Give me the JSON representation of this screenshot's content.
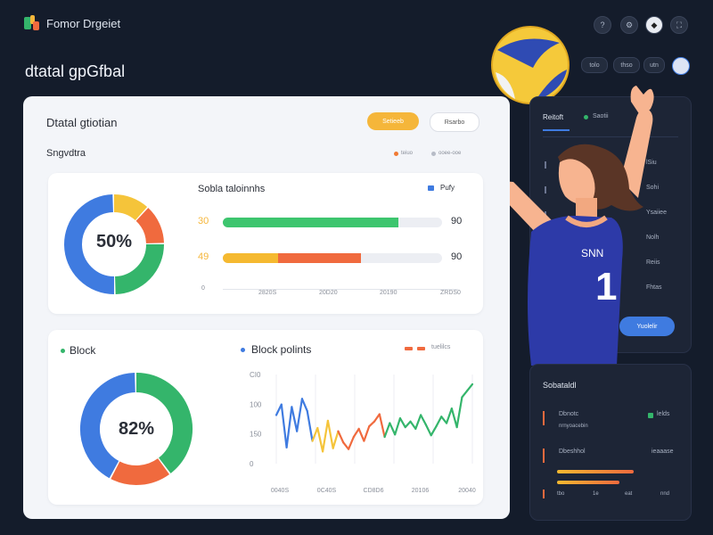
{
  "app": {
    "brand": "Fomor Drgeiet",
    "page_title": "dtatal gpGfbal",
    "top_icons": [
      "help-icon",
      "settings-icon",
      "notification-icon",
      "fullscreen-icon"
    ],
    "secondary_pills": [
      "tolo",
      "thso",
      "utn"
    ]
  },
  "main": {
    "title": "Dtatal gtiotian",
    "btn_primary": "Setieeb",
    "btn_secondary": "Rsarbo",
    "section_label": "Sngvdtra",
    "legend": [
      {
        "label": "teiuo",
        "color": "#f07a34"
      },
      {
        "label": "ooee-ooe",
        "color": "#b7bcc7"
      }
    ],
    "top_panel": {
      "donut": {
        "center_label": "50%",
        "slices": [
          {
            "value": 12,
            "color": "#f5c43a"
          },
          {
            "value": 13,
            "color": "#f06a3e"
          },
          {
            "value": 25,
            "color": "#34b56b"
          },
          {
            "value": 50,
            "color": "#3f7be0"
          }
        ]
      },
      "bars_title": "Sobla taloinnhs",
      "bars_legend": "Pufy",
      "bars": [
        {
          "label": "30",
          "value_label": "90",
          "segments": [
            {
              "fraction": 0.8,
              "color": "#3dc56e"
            }
          ]
        },
        {
          "label": "49",
          "value_label": "90",
          "segments": [
            {
              "fraction": 0.25,
              "color": "#f5b930"
            },
            {
              "fraction": 0.38,
              "color": "#f06a3e"
            }
          ]
        }
      ],
      "axis_zero": "0",
      "ticks": [
        "2820S",
        "20D20",
        "20190",
        "ZRDS0"
      ]
    },
    "bottom_panel": {
      "block_label": "Block",
      "donut": {
        "center_label": "82%",
        "slices": [
          {
            "value": 40,
            "color": "#34b56b"
          },
          {
            "value": 18,
            "color": "#f06a3e"
          },
          {
            "value": 42,
            "color": "#3f7be0"
          }
        ]
      },
      "chart_title": "Block polints",
      "chart_legend": "tuelilcs",
      "y_ticks": [
        "CI0",
        "100",
        "150",
        "0"
      ],
      "x_ticks": [
        "0040S",
        "0C40S",
        "CD8D6",
        "20106",
        "20040"
      ]
    }
  },
  "chart_data": {
    "type": "line",
    "title": "Block polints",
    "ylabel": "",
    "xlabel": "",
    "series": [
      {
        "name": "tuelilcs",
        "values": [
          120,
          133,
          80,
          130,
          100,
          140,
          125,
          88,
          104,
          75,
          113,
          79,
          100,
          86,
          78,
          93,
          103,
          88,
          106,
          112,
          121,
          93,
          110,
          96,
          116,
          105,
          112,
          103,
          120,
          108,
          95,
          106,
          118,
          110,
          128,
          105,
          142,
          150,
          158
        ]
      }
    ],
    "y_tick_labels": [
      "CI0",
      "100",
      "150",
      "0"
    ],
    "x_tick_labels": [
      "0040S",
      "0C40S",
      "CD8D6",
      "20106",
      "20040"
    ]
  },
  "side": {
    "top_card": {
      "title": "Reitoft",
      "tab": "Saotii",
      "tab_color": "#34b56b",
      "rows": [
        "lSiu",
        "Sohi",
        "Ysaiiee",
        "Nolh",
        "Reiis",
        "Fhtas"
      ],
      "button": "Yuolelir"
    },
    "bottom_card": {
      "title": "Sobataldl",
      "items": [
        {
          "label": "Dbnotc",
          "sub": "nrnyoacebin",
          "tag": "lelds",
          "tag_color": "#34b56b"
        },
        {
          "label": "Dbeshhol",
          "sub": "",
          "tag": "ieaaase",
          "tag_color": "#f06a3e"
        }
      ],
      "axis": [
        "tbo",
        "1e",
        "eat",
        "nnd"
      ]
    }
  },
  "colors": {
    "accent": "#3f7be0",
    "orange": "#f5b63a",
    "green": "#34b56b",
    "red": "#f06a3e",
    "bg": "#141c2b"
  }
}
